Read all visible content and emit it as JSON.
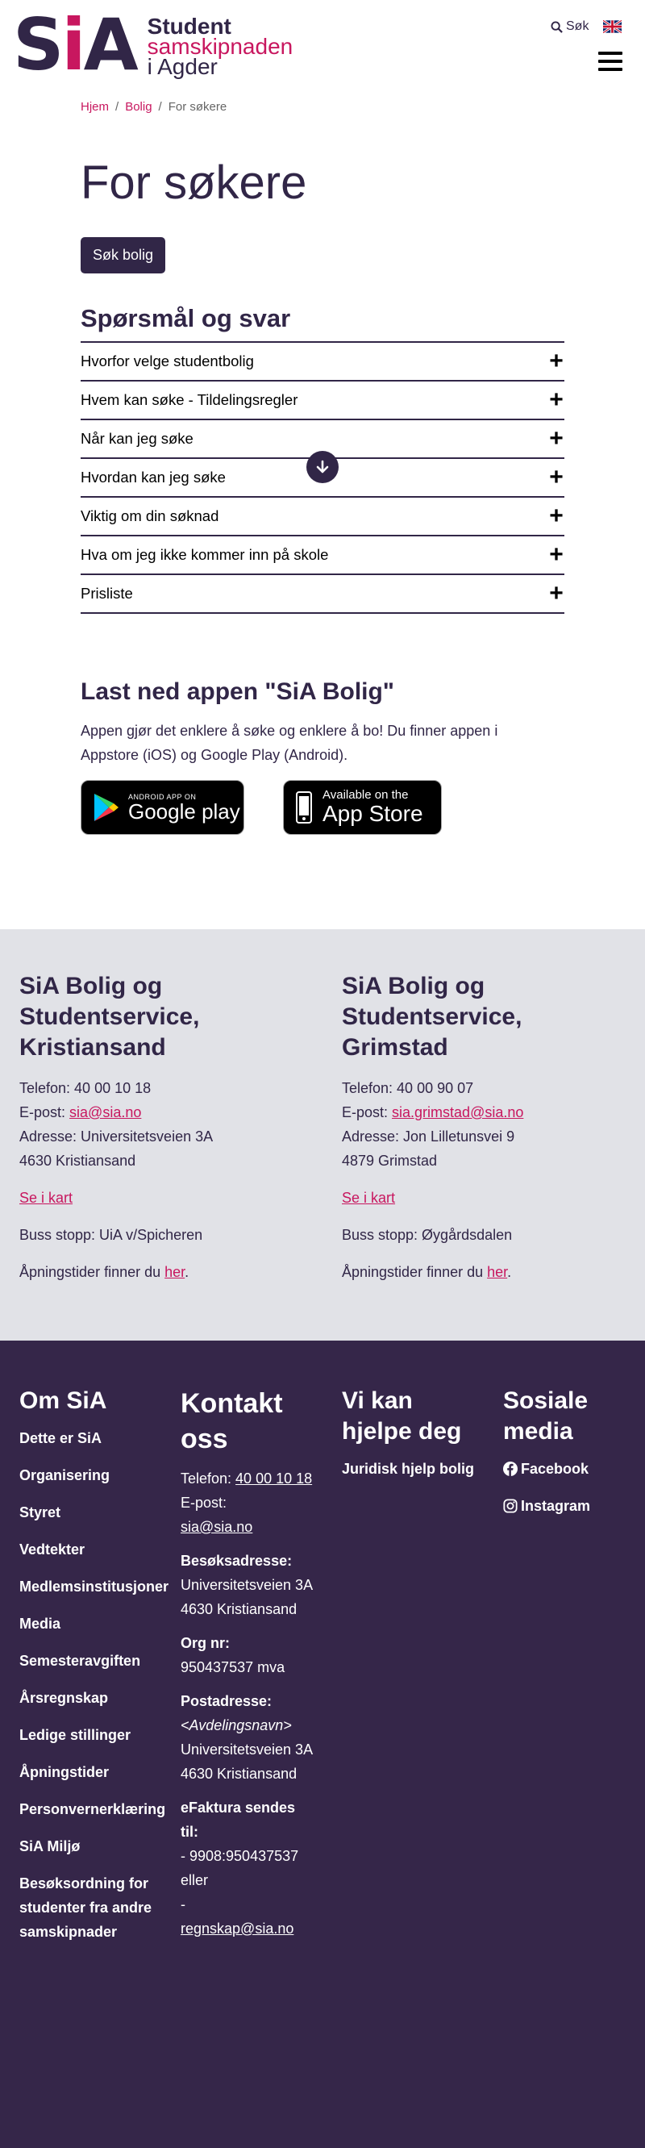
{
  "header": {
    "logo_mark": "SiA",
    "logo_line1": "Student",
    "logo_line2": "samskipnaden",
    "logo_line3": "i Agder",
    "search_label": "Søk"
  },
  "breadcrumb": {
    "home": "Hjem",
    "section": "Bolig",
    "current": "For søkere",
    "sep": "/"
  },
  "page_title": "For søkere",
  "cta_label": "Søk bolig",
  "faq": {
    "title": "Spørsmål og svar",
    "items": [
      "Hvorfor velge studentbolig",
      "Hvem kan søke - Tildelingsregler",
      "Når kan jeg søke",
      "Hvordan kan jeg søke",
      "Viktig om din søknad",
      "Hva om jeg ikke kommer inn på skole",
      "Prisliste"
    ]
  },
  "app": {
    "title": "Last ned appen \"SiA Bolig\"",
    "description": "Appen gjør det enklere å søke og enklere å bo! Du finner appen i Appstore (iOS) og Google Play (Android).",
    "gp_small": "ANDROID APP ON",
    "gp_big": "Google play",
    "as_small": "Available on the",
    "as_big": "App Store"
  },
  "offices": [
    {
      "title": "SiA Bolig og Studentservice, Kristiansand",
      "phone": "Telefon: 40 00 10 18",
      "email_label": "E-post: ",
      "email": "sia@sia.no",
      "address1": "Adresse: Universitetsveien 3A",
      "address2": "4630 Kristiansand",
      "map": "Se i kart",
      "bus": "Buss stopp: UiA v/Spicheren",
      "hours_text": "Åpningstider finner du ",
      "hours_link": "her",
      "hours_end": "."
    },
    {
      "title": "SiA Bolig og Studentservice, Grimstad",
      "phone": "Telefon: 40 00 90 07",
      "email_label": "E-post: ",
      "email": "sia.grimstad@sia.no",
      "address1": "Adresse: Jon Lilletunsvei 9",
      "address2": "4879 Grimstad",
      "map": "Se i kart",
      "bus": "Buss stopp: Øygårdsdalen",
      "hours_text": "Åpningstider finner du ",
      "hours_link": "her",
      "hours_end": "."
    }
  ],
  "footer": {
    "about": {
      "title": "Om SiA",
      "links": [
        "Dette er SiA",
        "Organisering",
        "Styret",
        "Vedtekter",
        "Medlemsinstitusjoner",
        "Media",
        "Semesteravgiften",
        "Årsregnskap",
        "Ledige stillinger",
        "Åpningstider",
        "Personvernerklæring",
        "SiA Miljø",
        "Besøksordning for studenter fra andre samskipnader"
      ]
    },
    "contact": {
      "title": "Kontakt oss",
      "phone_label": "Telefon: ",
      "phone": "40 00 10 18",
      "email_label": "E-post:",
      "email": "sia@sia.no",
      "visit_label": "Besøksadresse:",
      "visit_line1": "Universitetsveien 3A",
      "visit_line2": "4630 Kristiansand",
      "org_label": "Org nr:",
      "org": "950437537 mva",
      "post_label": "Postadresse:",
      "post_dept": "<Avdelingsnavn>",
      "post_line1": "Universitetsveien 3A",
      "post_line2": "4630 Kristiansand",
      "einv_label": "eFaktura sendes til:",
      "einv_line1": "- 9908:950437537 eller",
      "einv_dash": "-",
      "einv_email": "regnskap@sia.no"
    },
    "help": {
      "title": "Vi kan hjelpe deg",
      "links": [
        "Juridisk hjelp bolig"
      ]
    },
    "social": {
      "title": "Sosiale media",
      "facebook": "Facebook",
      "instagram": "Instagram"
    }
  },
  "colors": {
    "brand": "#312647",
    "accent": "#c8175f",
    "footer_bg": "#352649",
    "office_bg": "#e1e2e7"
  }
}
